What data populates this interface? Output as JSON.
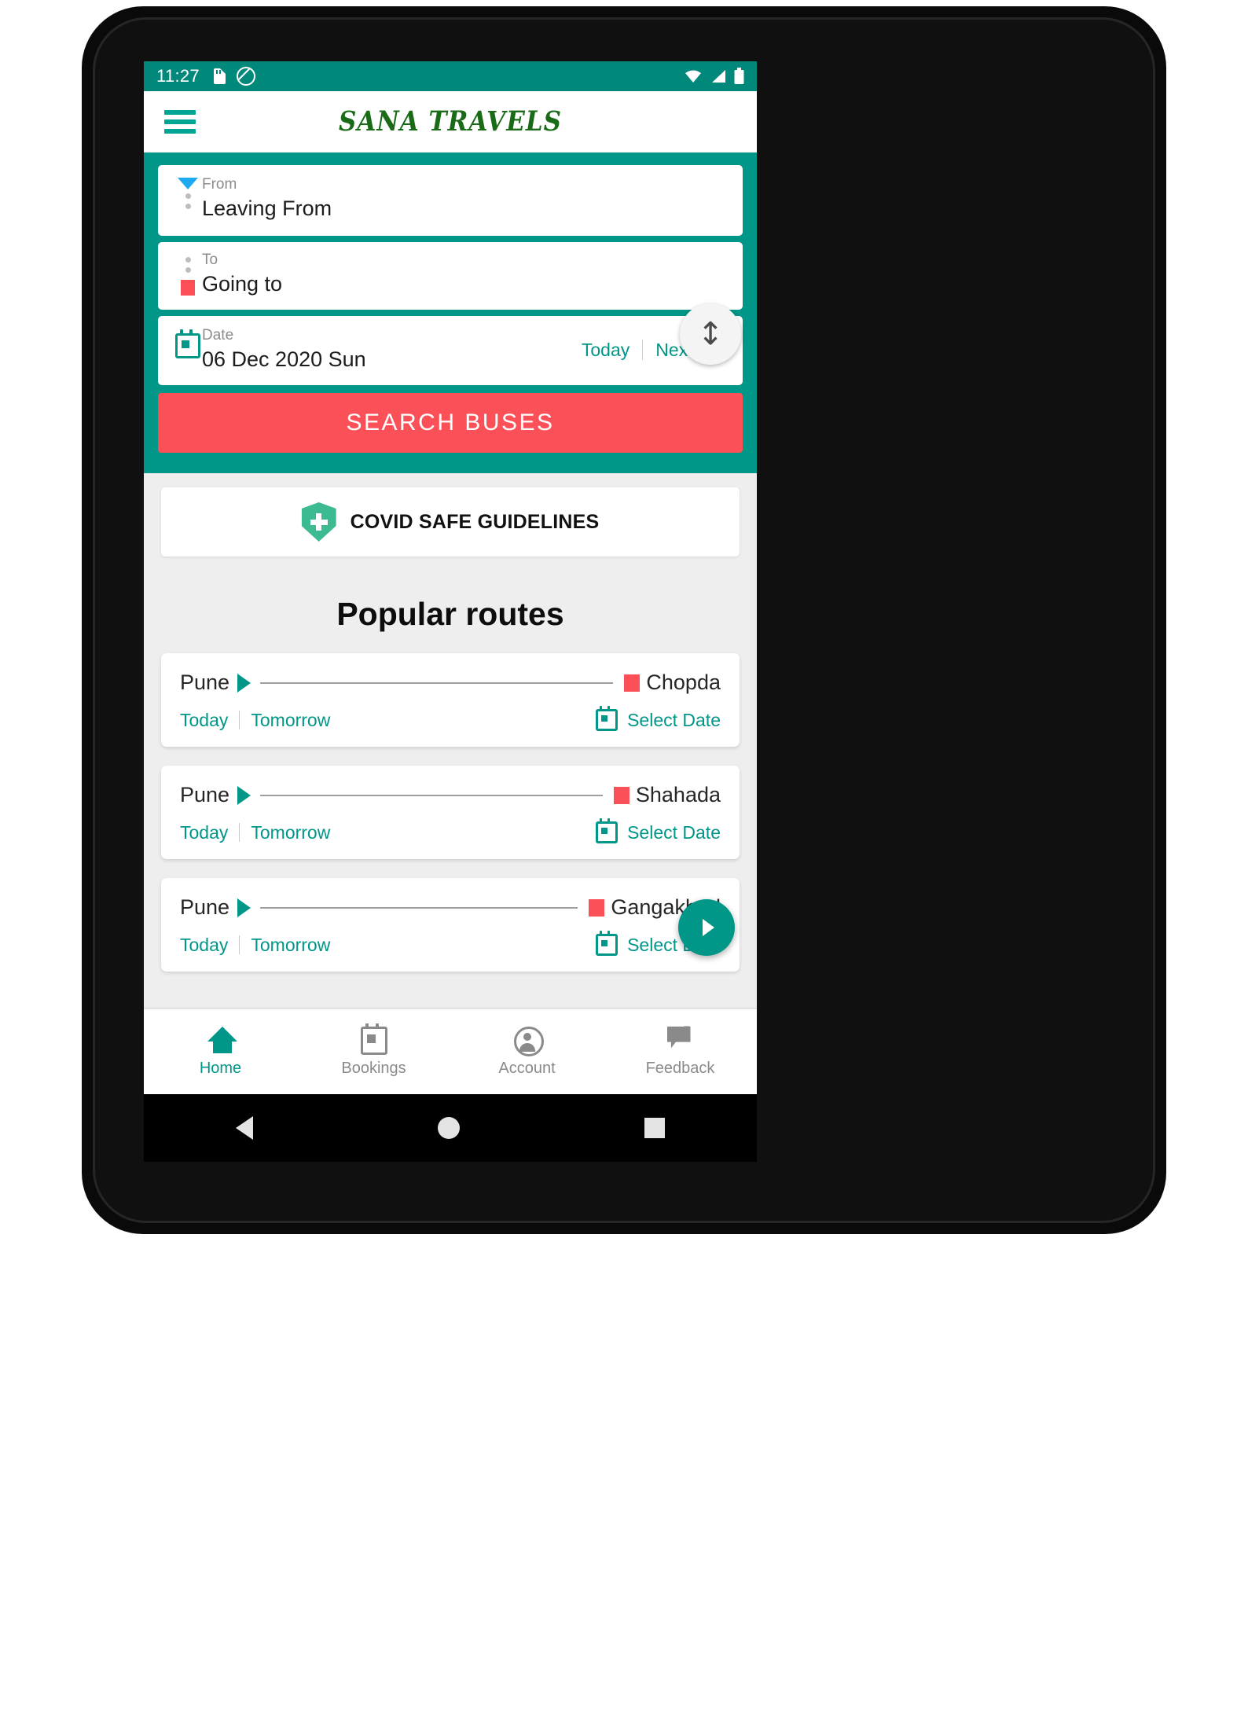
{
  "status_bar": {
    "time": "11:27",
    "icons": [
      "sd-card-icon",
      "mute-icon",
      "wifi-icon",
      "signal-icon",
      "battery-icon"
    ]
  },
  "app_bar": {
    "menu_icon": "hamburger-menu-icon",
    "brand": "SANA TRAVELS"
  },
  "search_panel": {
    "from": {
      "label": "From",
      "value": "Leaving From",
      "marker": "blue-triangle-down"
    },
    "to": {
      "label": "To",
      "value": "Going to",
      "marker": "red-square"
    },
    "swap_glyph": "↕",
    "date": {
      "label": "Date",
      "value": "06 Dec 2020 Sun",
      "today_label": "Today",
      "next_day_label": "Next day"
    },
    "search_button": "SEARCH BUSES"
  },
  "covid_banner": {
    "label": "COVID SAFE GUIDELINES",
    "icon": "shield-plus-icon"
  },
  "popular_routes": {
    "title": "Popular routes",
    "today_label": "Today",
    "tomorrow_label": "Tomorrow",
    "select_date_label": "Select Date",
    "items": [
      {
        "from": "Pune",
        "to": "Chopda"
      },
      {
        "from": "Pune",
        "to": "Shahada"
      },
      {
        "from": "Pune",
        "to": "Gangakhed"
      }
    ]
  },
  "bottom_nav": {
    "items": [
      {
        "label": "Home",
        "icon": "home-icon",
        "active": true
      },
      {
        "label": "Bookings",
        "icon": "calendar-icon",
        "active": false
      },
      {
        "label": "Account",
        "icon": "account-circle-icon",
        "active": false
      },
      {
        "label": "Feedback",
        "icon": "edit-note-icon",
        "active": false
      }
    ]
  },
  "android_nav": {
    "back": "back-key",
    "home": "home-key",
    "recents": "recents-key"
  },
  "colors": {
    "primary": "#009688",
    "status_bar": "#00897b",
    "accent_red": "#fb5058",
    "brand_green": "#1a6b17",
    "page_bg": "#eeeeee"
  }
}
